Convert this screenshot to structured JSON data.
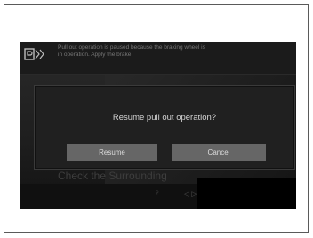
{
  "background_screen": {
    "hint_text": "Pull out operation is paused because the braking wheel is in operation. Apply the brake.",
    "bottom_label": "Check the Surrounding",
    "pager": "◁ ▷"
  },
  "dialog": {
    "message": "Resume pull out operation?",
    "resume_label": "Resume",
    "cancel_label": "Cancel"
  },
  "colors": {
    "dialog_bg": "#202020",
    "button_bg": "#666666",
    "text": "#d4d4d4"
  }
}
